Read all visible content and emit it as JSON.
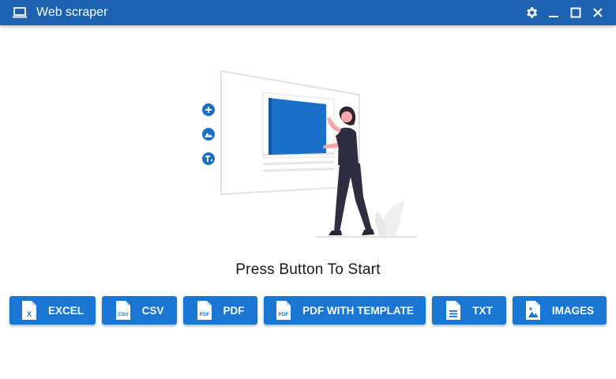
{
  "window": {
    "title": "Web scraper",
    "controls": [
      "settings-icon",
      "minimize-icon",
      "maximize-icon",
      "close-icon"
    ]
  },
  "main": {
    "prompt": "Press Button To Start"
  },
  "buttons": [
    {
      "label": "EXCEL",
      "icon": "excel-file-icon",
      "icon_text": "X"
    },
    {
      "label": "CSV",
      "icon": "csv-file-icon",
      "icon_text": "CSV"
    },
    {
      "label": "PDF",
      "icon": "pdf-file-icon",
      "icon_text": "PDF"
    },
    {
      "label": "PDF WITH TEMPLATE",
      "icon": "pdf-file-icon",
      "icon_text": "PDF"
    },
    {
      "label": "TXT",
      "icon": "text-file-icon"
    },
    {
      "label": "IMAGES",
      "icon": "image-file-icon"
    }
  ],
  "colors": {
    "titlebar": "#1d62b0",
    "accent": "#1976d2",
    "text": "#1a1a1a"
  }
}
